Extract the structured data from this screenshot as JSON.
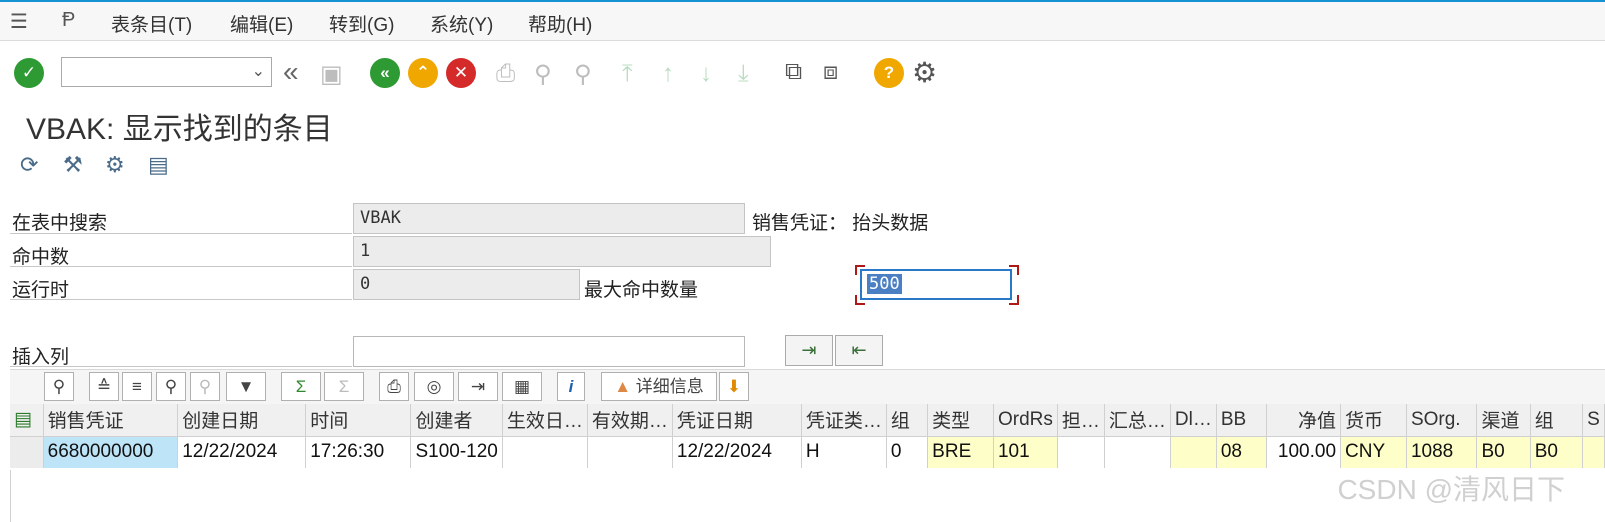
{
  "menu": {
    "items": [
      "表条目(T)",
      "编辑(E)",
      "转到(G)",
      "系统(Y)",
      "帮助(H)"
    ]
  },
  "toolbar": {
    "command_value": "",
    "icons": [
      "enter-icon",
      "save-icon",
      "back-icon",
      "exit-icon",
      "cancel-icon",
      "print-icon",
      "find-icon",
      "find-next-icon",
      "first-page-icon",
      "prev-page-icon",
      "next-page-icon",
      "last-page-icon",
      "new-session-icon",
      "shortcut-icon",
      "help-icon",
      "settings-icon"
    ]
  },
  "title": "VBAK: 显示找到的条目",
  "form": {
    "search_table_label": "在表中搜索",
    "search_table_value": "VBAK",
    "table_description": "销售凭证： 抬头数据",
    "hits_label": "命中数",
    "hits_value": "1",
    "runtime_label": "运行时",
    "runtime_value": "0",
    "max_hits_label": "最大命中数量",
    "max_hits_value": "500",
    "insert_col_label": "插入列",
    "insert_col_value": ""
  },
  "grid_toolbar": {
    "details_label": "详细信息"
  },
  "table": {
    "columns": [
      "销售凭证",
      "创建日期",
      "时间",
      "创建者",
      "生效日…",
      "有效期…",
      "凭证日期",
      "凭证类…",
      "组",
      "类型",
      "OrdRs",
      "担…",
      "汇总…",
      "Dl…",
      "BB",
      "净值",
      "货币",
      "SOrg.",
      "渠道",
      "组",
      "S"
    ],
    "rows": [
      [
        "6680000000",
        "12/22/2024",
        "17:26:30",
        "S100-120",
        "",
        "",
        "12/22/2024",
        "H",
        "0",
        "BRE",
        "101",
        "",
        "",
        "",
        "08",
        "100.00",
        "CNY",
        "1088",
        "B0",
        "B0",
        ""
      ]
    ]
  },
  "watermark": "CSDN @清风日下",
  "colors": {
    "key_cell": "#bde4f7",
    "yellow_cell": "#fefec8",
    "header": "#f0f0f0",
    "accent": "#1592d1"
  }
}
